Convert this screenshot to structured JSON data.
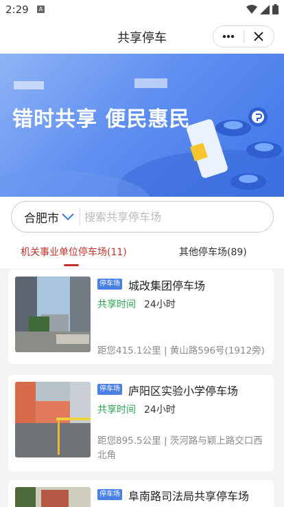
{
  "status": {
    "time": "2:29",
    "notif": "A"
  },
  "nav": {
    "title": "共享停车"
  },
  "banner": {
    "headline": "错时共享 便民惠民"
  },
  "search": {
    "city": "合肥市",
    "placeholder": "搜索共享停车场"
  },
  "tabs": [
    {
      "label": "机关事业单位停车场(11)"
    },
    {
      "label": "其他停车场(89)"
    }
  ],
  "lots": [
    {
      "tag": "停车场",
      "name": "城改集团停车场",
      "time_label": "共享时间",
      "time_value": "24小时",
      "info": "距您415.1公里 | 黄山路596号(1912旁)"
    },
    {
      "tag": "停车场",
      "name": "庐阳区实验小学停车场",
      "time_label": "共享时间",
      "time_value": "24小时",
      "info": "距您895.5公里 | 茨河路与颖上路交口西北角"
    },
    {
      "tag": "停车场",
      "name": "阜南路司法局共享停车场"
    }
  ],
  "colors": {
    "accent_red": "#c2332b",
    "tag_blue": "#4a7fe6",
    "time_green": "#2aa44f"
  }
}
